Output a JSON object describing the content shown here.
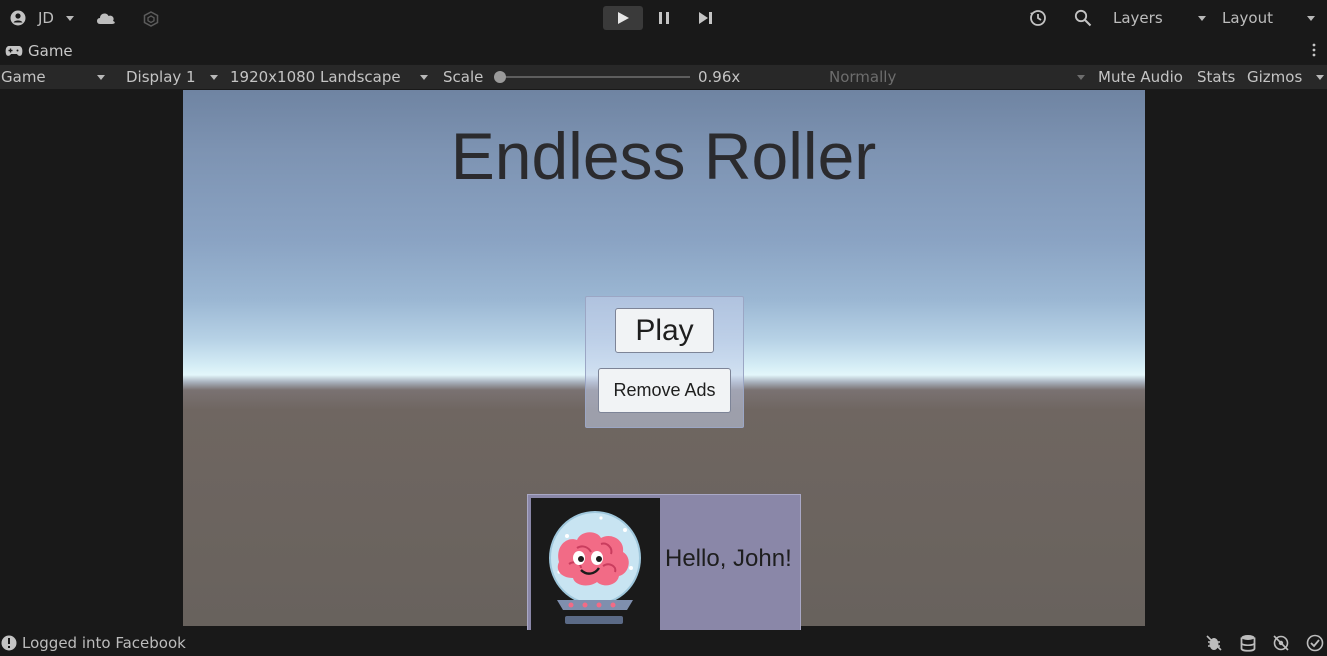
{
  "toolbar": {
    "account_label": "JD",
    "layers_label": "Layers",
    "layout_label": "Layout"
  },
  "game_tab": {
    "tab_label": "Game"
  },
  "game_bar": {
    "view_mode": "Game",
    "display": "Display 1",
    "resolution": "1920x1080 Landscape",
    "scale_label": "Scale",
    "scale_value": "0.96x",
    "play_mode": "Normally",
    "mute_audio": "Mute Audio",
    "stats": "Stats",
    "gizmos": "Gizmos"
  },
  "game": {
    "title": "Endless Roller",
    "play_button": "Play",
    "remove_ads_button": "Remove Ads",
    "greeting": "Hello, John!"
  },
  "status": {
    "message": "Logged into Facebook"
  },
  "colors": {
    "editor_bg": "#191919",
    "toolbar_bg": "#282828",
    "panel_tint": "#c3cee9",
    "profile_bg": "#8a87a8"
  },
  "icons": [
    "account-icon",
    "cloud-icon",
    "collab-icon",
    "play-icon",
    "pause-icon",
    "step-icon",
    "history-icon",
    "search-icon",
    "gamepad-icon",
    "more-icon",
    "info-icon",
    "bug-icon",
    "database-icon",
    "network-icon",
    "check-icon",
    "brain-avatar-icon"
  ]
}
